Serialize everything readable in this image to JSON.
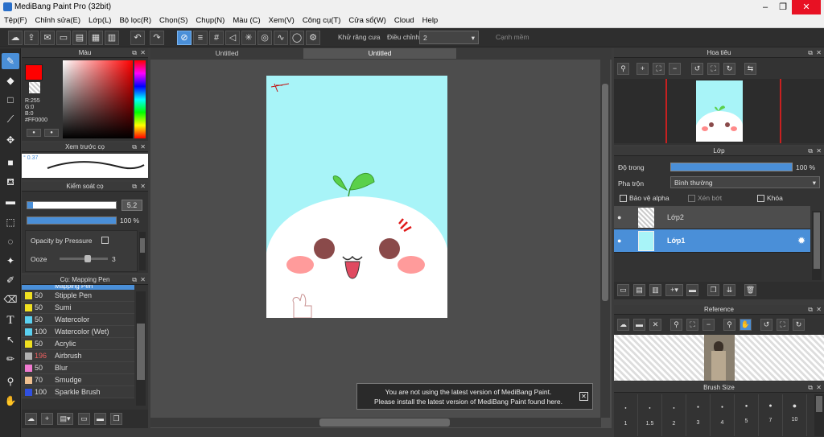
{
  "app": {
    "title": "MediBang Paint Pro (32bit)"
  },
  "menu": [
    "Tệp(F)",
    "Chỉnh sửa(E)",
    "Lớp(L)",
    "Bộ lọc(R)",
    "Chọn(S)",
    "Chụp(N)",
    "Màu (C)",
    "Xem(V)",
    "Công cụ(T)",
    "Cửa sổ(W)",
    "Cloud",
    "Help"
  ],
  "toolbar": {
    "antialias_label": "Khử răng cưa",
    "correction_label": "Điều chỉnh",
    "correction_value": "2",
    "sharp_label": "Cạnh mềm"
  },
  "color_panel": {
    "title": "Màu",
    "r": "R:255",
    "g": "G:0",
    "b": "B:0",
    "hex": "#FF0000",
    "primary": "#ff0000"
  },
  "brush_preview": {
    "title": "Xem trước cọ",
    "size": "0.37"
  },
  "brush_control": {
    "title": "Kiểm soát cọ",
    "size": "5.2",
    "opacity": "100 %",
    "opacity_pressure": "Opacity by Pressure",
    "ooze_label": "Ooze",
    "ooze_value": "3"
  },
  "brush_list": {
    "title": "Cọ: Mapping Pen",
    "top_item": "Mapping Pen",
    "items": [
      {
        "size": "50",
        "name": "Stipple Pen",
        "color": "#f0e020"
      },
      {
        "size": "50",
        "name": "Sumi",
        "color": "#f0e020"
      },
      {
        "size": "50",
        "name": "Watercolor",
        "color": "#5ad0f0"
      },
      {
        "size": "100",
        "name": "Watercolor (Wet)",
        "color": "#5ad0f0"
      },
      {
        "size": "50",
        "name": "Acrylic",
        "color": "#f0e020"
      },
      {
        "size": "196",
        "name": "Airbrush",
        "color": "#b0b0b0"
      },
      {
        "size": "50",
        "name": "Blur",
        "color": "#f07ad0"
      },
      {
        "size": "70",
        "name": "Smudge",
        "color": "#f0c090"
      },
      {
        "size": "100",
        "name": "Sparkle Brush",
        "color": "#3050e0"
      }
    ]
  },
  "canvas": {
    "tabs": [
      "Untitled",
      "Untitled"
    ],
    "notice_line1": "You are not using the latest version of MediBang Paint.",
    "notice_line2": "Please install the latest version of MediBang Paint found here."
  },
  "navigator": {
    "title": "Hoa tiêu"
  },
  "layers": {
    "title": "Lớp",
    "opacity_label": "Độ trong",
    "opacity_value": "100 %",
    "blend_label": "Pha trộn",
    "blend_value": "Bình thường",
    "protect_alpha": "Bảo vệ alpha",
    "clipping": "Xén bớt",
    "lock": "Khóa",
    "items": [
      {
        "name": "Lớp2"
      },
      {
        "name": "Lớp1"
      }
    ]
  },
  "reference": {
    "title": "Reference"
  },
  "brush_size": {
    "title": "Brush Size",
    "sizes": [
      "1",
      "1.5",
      "2",
      "3",
      "4",
      "5",
      "7",
      "10"
    ]
  },
  "colors": {
    "accent": "#4a8fd8",
    "canvas_bg": "#a8f4f8"
  }
}
